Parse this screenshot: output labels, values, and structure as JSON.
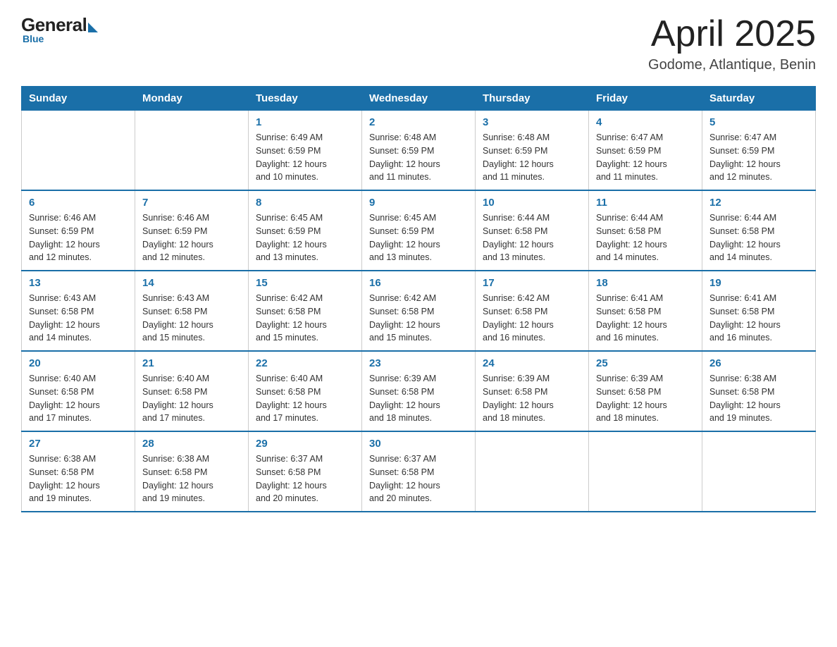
{
  "header": {
    "logo_general": "General",
    "logo_blue": "Blue",
    "month": "April 2025",
    "location": "Godome, Atlantique, Benin"
  },
  "days_of_week": [
    "Sunday",
    "Monday",
    "Tuesday",
    "Wednesday",
    "Thursday",
    "Friday",
    "Saturday"
  ],
  "weeks": [
    [
      {
        "num": "",
        "info": ""
      },
      {
        "num": "",
        "info": ""
      },
      {
        "num": "1",
        "info": "Sunrise: 6:49 AM\nSunset: 6:59 PM\nDaylight: 12 hours\nand 10 minutes."
      },
      {
        "num": "2",
        "info": "Sunrise: 6:48 AM\nSunset: 6:59 PM\nDaylight: 12 hours\nand 11 minutes."
      },
      {
        "num": "3",
        "info": "Sunrise: 6:48 AM\nSunset: 6:59 PM\nDaylight: 12 hours\nand 11 minutes."
      },
      {
        "num": "4",
        "info": "Sunrise: 6:47 AM\nSunset: 6:59 PM\nDaylight: 12 hours\nand 11 minutes."
      },
      {
        "num": "5",
        "info": "Sunrise: 6:47 AM\nSunset: 6:59 PM\nDaylight: 12 hours\nand 12 minutes."
      }
    ],
    [
      {
        "num": "6",
        "info": "Sunrise: 6:46 AM\nSunset: 6:59 PM\nDaylight: 12 hours\nand 12 minutes."
      },
      {
        "num": "7",
        "info": "Sunrise: 6:46 AM\nSunset: 6:59 PM\nDaylight: 12 hours\nand 12 minutes."
      },
      {
        "num": "8",
        "info": "Sunrise: 6:45 AM\nSunset: 6:59 PM\nDaylight: 12 hours\nand 13 minutes."
      },
      {
        "num": "9",
        "info": "Sunrise: 6:45 AM\nSunset: 6:59 PM\nDaylight: 12 hours\nand 13 minutes."
      },
      {
        "num": "10",
        "info": "Sunrise: 6:44 AM\nSunset: 6:58 PM\nDaylight: 12 hours\nand 13 minutes."
      },
      {
        "num": "11",
        "info": "Sunrise: 6:44 AM\nSunset: 6:58 PM\nDaylight: 12 hours\nand 14 minutes."
      },
      {
        "num": "12",
        "info": "Sunrise: 6:44 AM\nSunset: 6:58 PM\nDaylight: 12 hours\nand 14 minutes."
      }
    ],
    [
      {
        "num": "13",
        "info": "Sunrise: 6:43 AM\nSunset: 6:58 PM\nDaylight: 12 hours\nand 14 minutes."
      },
      {
        "num": "14",
        "info": "Sunrise: 6:43 AM\nSunset: 6:58 PM\nDaylight: 12 hours\nand 15 minutes."
      },
      {
        "num": "15",
        "info": "Sunrise: 6:42 AM\nSunset: 6:58 PM\nDaylight: 12 hours\nand 15 minutes."
      },
      {
        "num": "16",
        "info": "Sunrise: 6:42 AM\nSunset: 6:58 PM\nDaylight: 12 hours\nand 15 minutes."
      },
      {
        "num": "17",
        "info": "Sunrise: 6:42 AM\nSunset: 6:58 PM\nDaylight: 12 hours\nand 16 minutes."
      },
      {
        "num": "18",
        "info": "Sunrise: 6:41 AM\nSunset: 6:58 PM\nDaylight: 12 hours\nand 16 minutes."
      },
      {
        "num": "19",
        "info": "Sunrise: 6:41 AM\nSunset: 6:58 PM\nDaylight: 12 hours\nand 16 minutes."
      }
    ],
    [
      {
        "num": "20",
        "info": "Sunrise: 6:40 AM\nSunset: 6:58 PM\nDaylight: 12 hours\nand 17 minutes."
      },
      {
        "num": "21",
        "info": "Sunrise: 6:40 AM\nSunset: 6:58 PM\nDaylight: 12 hours\nand 17 minutes."
      },
      {
        "num": "22",
        "info": "Sunrise: 6:40 AM\nSunset: 6:58 PM\nDaylight: 12 hours\nand 17 minutes."
      },
      {
        "num": "23",
        "info": "Sunrise: 6:39 AM\nSunset: 6:58 PM\nDaylight: 12 hours\nand 18 minutes."
      },
      {
        "num": "24",
        "info": "Sunrise: 6:39 AM\nSunset: 6:58 PM\nDaylight: 12 hours\nand 18 minutes."
      },
      {
        "num": "25",
        "info": "Sunrise: 6:39 AM\nSunset: 6:58 PM\nDaylight: 12 hours\nand 18 minutes."
      },
      {
        "num": "26",
        "info": "Sunrise: 6:38 AM\nSunset: 6:58 PM\nDaylight: 12 hours\nand 19 minutes."
      }
    ],
    [
      {
        "num": "27",
        "info": "Sunrise: 6:38 AM\nSunset: 6:58 PM\nDaylight: 12 hours\nand 19 minutes."
      },
      {
        "num": "28",
        "info": "Sunrise: 6:38 AM\nSunset: 6:58 PM\nDaylight: 12 hours\nand 19 minutes."
      },
      {
        "num": "29",
        "info": "Sunrise: 6:37 AM\nSunset: 6:58 PM\nDaylight: 12 hours\nand 20 minutes."
      },
      {
        "num": "30",
        "info": "Sunrise: 6:37 AM\nSunset: 6:58 PM\nDaylight: 12 hours\nand 20 minutes."
      },
      {
        "num": "",
        "info": ""
      },
      {
        "num": "",
        "info": ""
      },
      {
        "num": "",
        "info": ""
      }
    ]
  ]
}
